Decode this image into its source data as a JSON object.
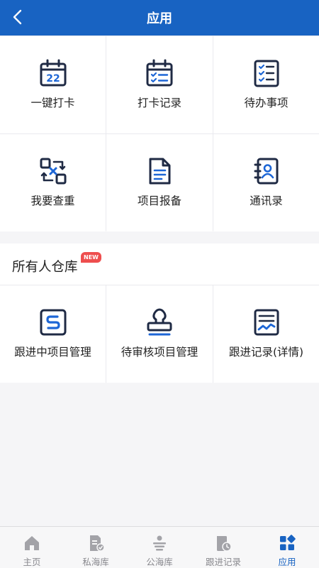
{
  "header": {
    "title": "应用"
  },
  "apps": [
    {
      "label": "一键打卡",
      "icon": "calendar-22-icon"
    },
    {
      "label": "打卡记录",
      "icon": "calendar-checklist-icon"
    },
    {
      "label": "待办事项",
      "icon": "todo-checklist-icon"
    },
    {
      "label": "我要查重",
      "icon": "duplicate-check-icon"
    },
    {
      "label": "项目报备",
      "icon": "document-report-icon"
    },
    {
      "label": "通讯录",
      "icon": "contacts-book-icon"
    }
  ],
  "calendar_number": "22",
  "section": {
    "title": "所有人仓库",
    "badge": "NEW"
  },
  "warehouse": [
    {
      "label": "跟进中项目管理",
      "icon": "s-box-icon"
    },
    {
      "label": "待审核项目管理",
      "icon": "stamp-icon"
    },
    {
      "label": "跟进记录(详情)",
      "icon": "chart-document-icon"
    }
  ],
  "tabs": [
    {
      "label": "主页",
      "icon": "home-icon"
    },
    {
      "label": "私海库",
      "icon": "private-pool-icon"
    },
    {
      "label": "公海库",
      "icon": "public-pool-icon"
    },
    {
      "label": "跟进记录",
      "icon": "follow-record-icon"
    },
    {
      "label": "应用",
      "icon": "apps-grid-icon",
      "active": true
    }
  ],
  "colors": {
    "brand": "#1863c2",
    "icon_dark": "#1f2a44",
    "icon_accent": "#1d66d6",
    "badge": "#ee4e4e",
    "tab_inactive": "#8a8a8f"
  }
}
